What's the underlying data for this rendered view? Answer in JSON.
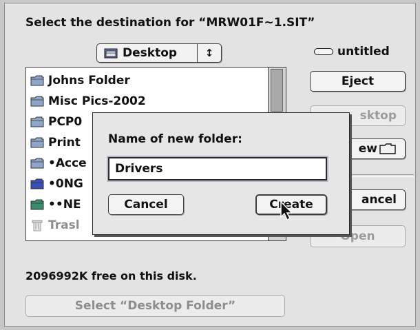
{
  "dialog": {
    "prompt": "Select the destination for “MRW01F~1.SIT”",
    "location_popup": {
      "value": "Desktop",
      "icon": "folder-icon",
      "arrows": "↕"
    },
    "disk_name": "untitled",
    "file_list": [
      {
        "name": "Johns Folder",
        "icon": "folder-icon",
        "dim": false
      },
      {
        "name": "Misc Pics-2002",
        "icon": "folder-icon",
        "dim": false
      },
      {
        "name": "PCP0",
        "icon": "folder-icon",
        "dim": false
      },
      {
        "name": "Print",
        "icon": "folder-icon",
        "dim": false
      },
      {
        "name": "•Acce",
        "icon": "folder-icon",
        "dim": false
      },
      {
        "name": "•0NG",
        "icon": "folder-blue-icon",
        "dim": false
      },
      {
        "name": "••NE",
        "icon": "folder-green-icon",
        "dim": false
      },
      {
        "name": "Trasl",
        "icon": "trash-icon",
        "dim": true
      }
    ],
    "buttons": {
      "eject": "Eject",
      "desktop": "sktop",
      "new": "ew",
      "cancel": "ancel",
      "open": "Open"
    },
    "free_space": "2096992K free on this disk.",
    "select_button": "Select “Desktop Folder”"
  },
  "modal": {
    "label": "Name of new folder:",
    "input_value": "Drivers",
    "cancel_label": "Cancel",
    "create_label": "Create"
  },
  "colors": {
    "folder": "#8ea6c8",
    "folder_blue": "#3a4fb5",
    "folder_green": "#3c8a6c",
    "window_bg": "#e3e3e3"
  }
}
